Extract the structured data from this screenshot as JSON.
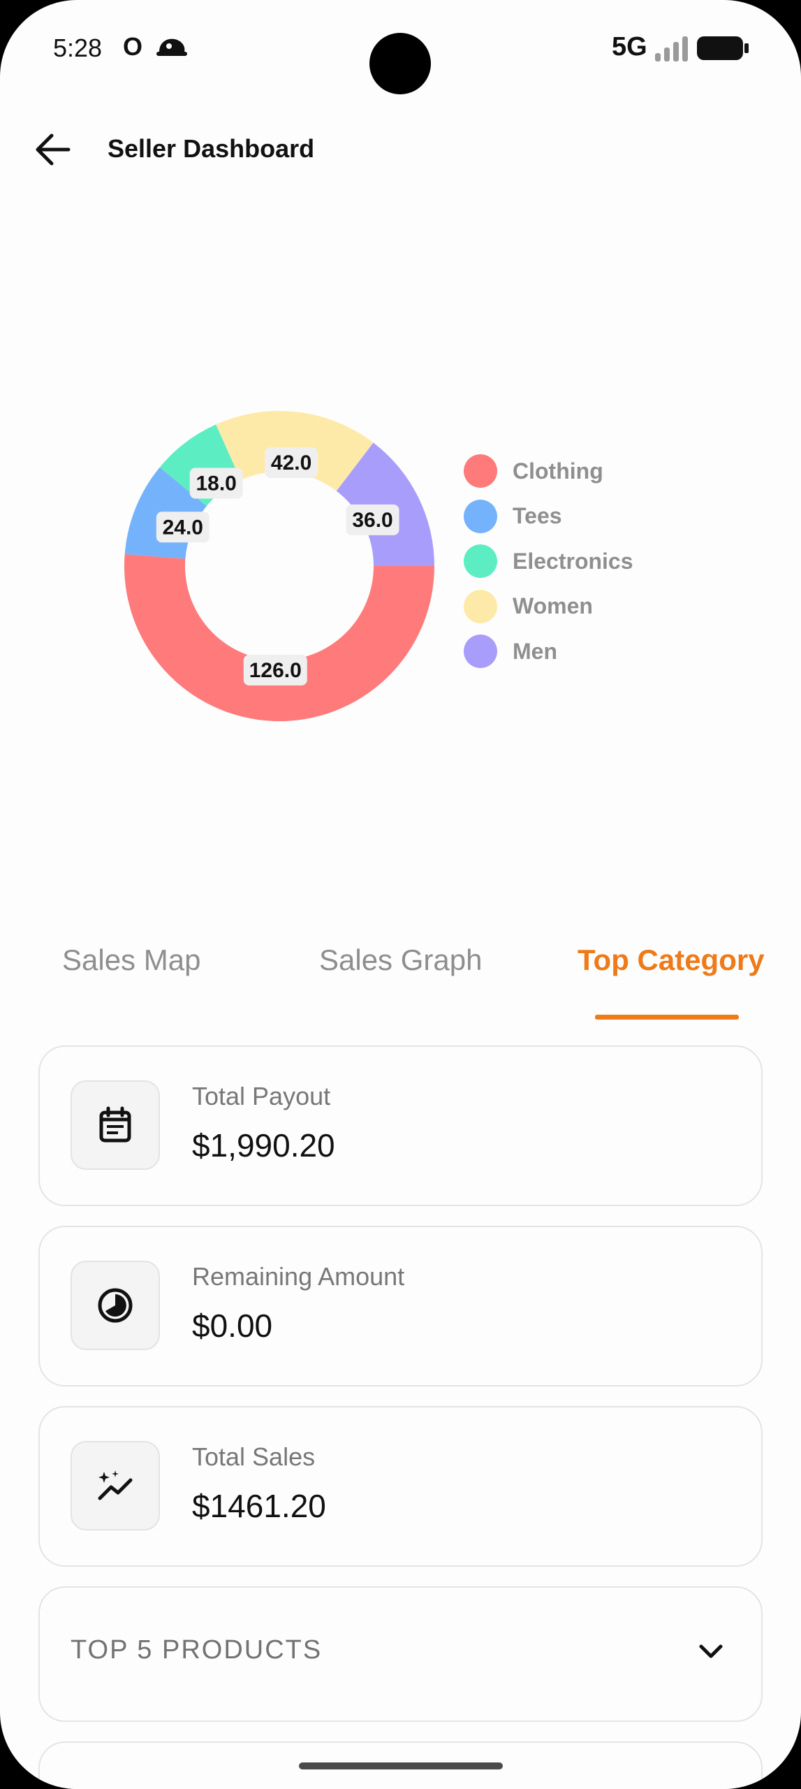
{
  "status_bar": {
    "time": "5:28",
    "app_letter": "O",
    "network": "5G",
    "icons": [
      "app-notification-icon",
      "signal-icon",
      "battery-icon"
    ]
  },
  "header": {
    "title": "Seller Dashboard",
    "back_icon": "arrow-left-icon"
  },
  "chart_data": {
    "type": "pie",
    "style": "donut",
    "legend_position": "right",
    "slices": [
      {
        "name": "Clothing",
        "value": 126.0,
        "label": "126.0",
        "color": "#ff7a7a"
      },
      {
        "name": "Tees",
        "value": 24.0,
        "label": "24.0",
        "color": "#74b2fc"
      },
      {
        "name": "Electronics",
        "value": 18.0,
        "label": "18.0",
        "color": "#5ceec2"
      },
      {
        "name": "Women",
        "value": 42.0,
        "label": "42.0",
        "color": "#feeaa8"
      },
      {
        "name": "Men",
        "value": 36.0,
        "label": "36.0",
        "color": "#a99dfc"
      }
    ]
  },
  "tabs": {
    "items": [
      {
        "label": "Sales Map"
      },
      {
        "label": "Sales Graph"
      },
      {
        "label": "Top Category"
      }
    ],
    "active": "Top Category",
    "accent": "#ee7a18"
  },
  "cards": [
    {
      "label": "Total Payout",
      "value": "$1,990.20",
      "icon": "calendar-icon"
    },
    {
      "label": "Remaining Amount",
      "value": "$0.00",
      "icon": "pie-progress-icon"
    },
    {
      "label": "Total Sales",
      "value": "$1461.20",
      "icon": "sparkle-trend-icon"
    }
  ],
  "accordion": {
    "label": "TOP 5 PRODUCTS",
    "icon": "chevron-down-icon"
  }
}
